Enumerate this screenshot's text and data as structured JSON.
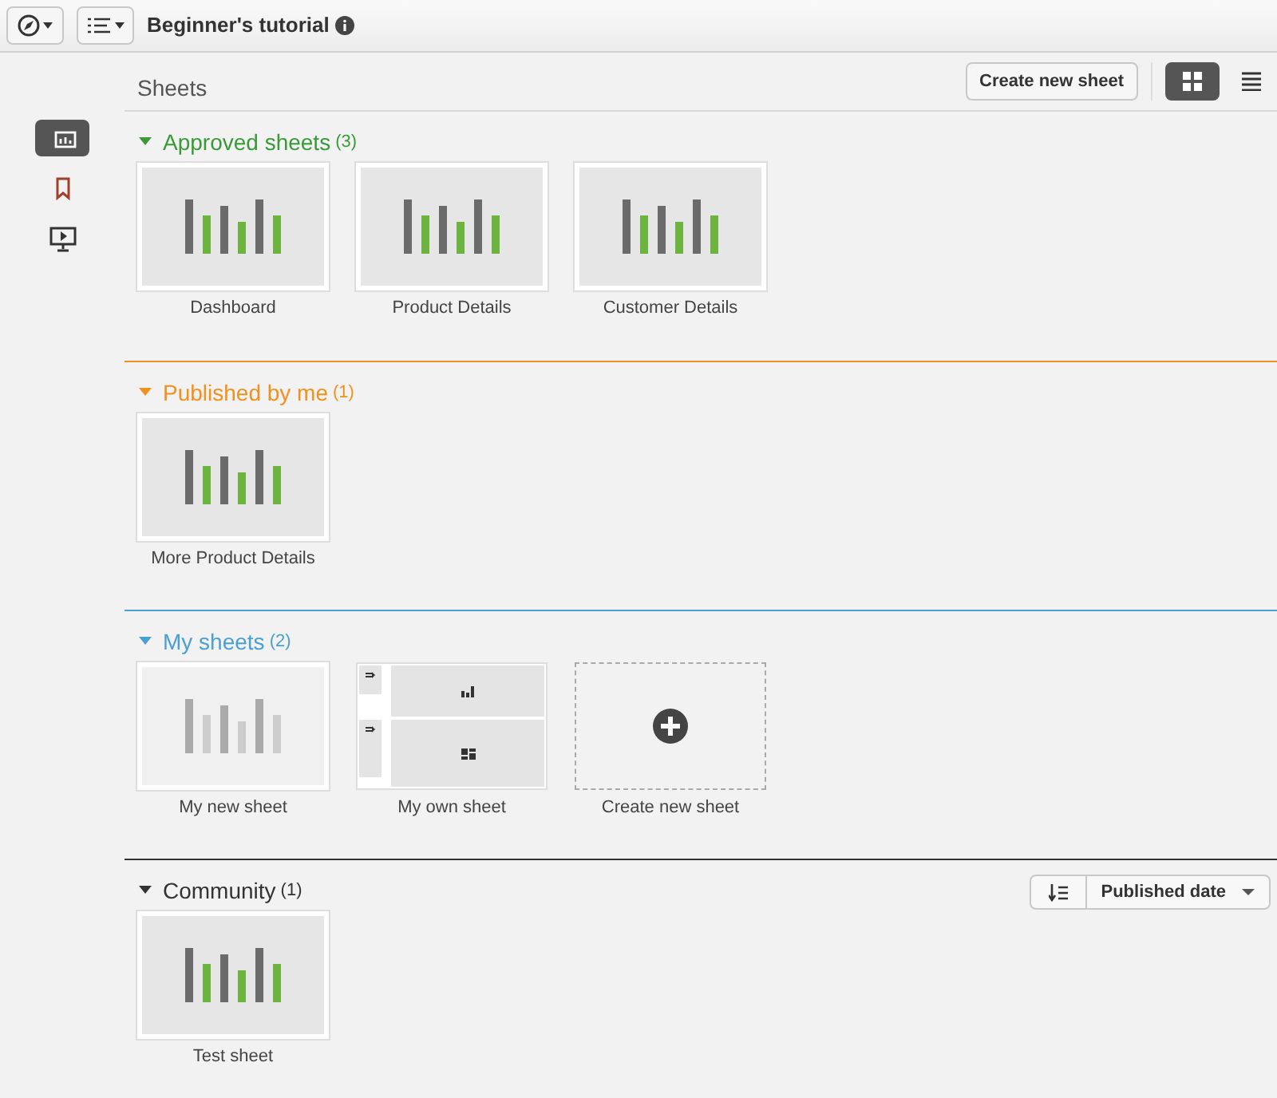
{
  "toolbar": {
    "title": "Beginner's tutorial"
  },
  "sidebar": {
    "items": [
      {
        "selected": true
      },
      {
        "selected": false
      },
      {
        "selected": false
      }
    ]
  },
  "header": {
    "title": "Sheets",
    "create_button": "Create new sheet",
    "views": [
      {
        "selected": true
      },
      {
        "selected": false
      }
    ]
  },
  "sections": [
    {
      "title": "Approved sheets",
      "count": "(3)",
      "color": "#3a9a3a",
      "expanded": true,
      "sheets": [
        {
          "kind": "bars",
          "label": "Dashboard"
        },
        {
          "kind": "bars",
          "label": "Product Details"
        },
        {
          "kind": "bars",
          "label": "Customer Details"
        }
      ]
    },
    {
      "title": "Published by me",
      "count": "(1)",
      "color": "#f0901e",
      "expanded": true,
      "sheets": [
        {
          "kind": "bars",
          "label": "More Product Details"
        }
      ]
    },
    {
      "title": "My sheets",
      "count": "(2)",
      "color": "#4aa0d0",
      "expanded": true,
      "sheets": [
        {
          "kind": "faded",
          "label": "My new sheet"
        },
        {
          "kind": "layout",
          "label": "My own sheet"
        },
        {
          "kind": "create",
          "label": "Create new sheet"
        }
      ]
    },
    {
      "title": "Community",
      "count": "(1)",
      "color": "#333333",
      "expanded": true,
      "sort": {
        "label": "Published date"
      },
      "sheets": [
        {
          "kind": "bars",
          "label": "Test sheet"
        }
      ]
    }
  ]
}
